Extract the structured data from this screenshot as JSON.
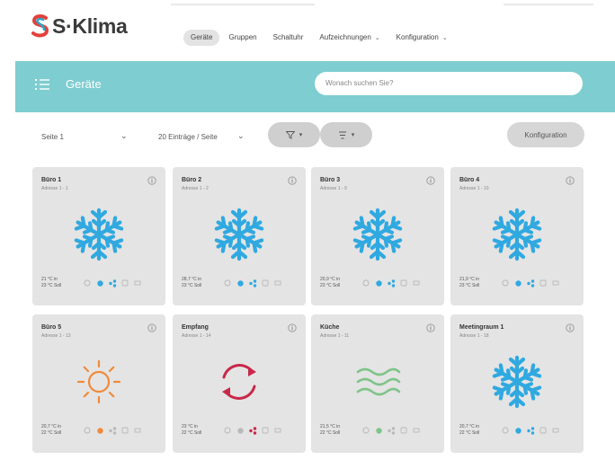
{
  "brand": {
    "name": "S·Klima"
  },
  "nav": {
    "items": [
      {
        "label": "Geräte",
        "active": true
      },
      {
        "label": "Gruppen",
        "active": false
      },
      {
        "label": "Schaltuhr",
        "active": false
      },
      {
        "label": "Aufzeichnungen",
        "active": false,
        "dropdown": true
      },
      {
        "label": "Konfiguration",
        "active": false,
        "dropdown": true
      }
    ]
  },
  "header": {
    "title": "Geräte",
    "search_placeholder": "Wonach suchen Sie?"
  },
  "toolbar": {
    "page_select": "Seite 1",
    "per_page_select": "20 Einträge / Seite",
    "konfiguration_label": "Konfiguration"
  },
  "colors": {
    "accent_teal": "#7ecdd0",
    "snow_blue": "#30a9e0",
    "sun_orange": "#f08a3a",
    "cycle_red": "#c8284a",
    "wave_green": "#7fc48a"
  },
  "devices": [
    {
      "name": "Büro 1",
      "address": "Adresse 1 - 1",
      "temp_line1": "21 °C in",
      "temp_line2": "23 °C Soll",
      "mode_icon": "snowflake-icon"
    },
    {
      "name": "Büro 2",
      "address": "Adresse 1 - 2",
      "temp_line1": "28,7 °C in",
      "temp_line2": "23 °C Soll",
      "mode_icon": "snowflake-icon"
    },
    {
      "name": "Büro 3",
      "address": "Adresse 1 - 9",
      "temp_line1": "20,9 °C in",
      "temp_line2": "23 °C Soll",
      "mode_icon": "snowflake-icon"
    },
    {
      "name": "Büro 4",
      "address": "Adresse 1 - 10",
      "temp_line1": "21,9 °C in",
      "temp_line2": "23 °C Soll",
      "mode_icon": "snowflake-icon"
    },
    {
      "name": "Büro 5",
      "address": "Adresse 1 - 13",
      "temp_line1": "20,7 °C in",
      "temp_line2": "22 °C Soll",
      "mode_icon": "sun-icon"
    },
    {
      "name": "Empfang",
      "address": "Adresse 1 - 14",
      "temp_line1": "23 °C in",
      "temp_line2": "22 °C Soll",
      "mode_icon": "auto-cycle-icon"
    },
    {
      "name": "Küche",
      "address": "Adresse 1 - 11",
      "temp_line1": "21,5 °C in",
      "temp_line2": "22 °C Soll",
      "mode_icon": "fan-waves-icon"
    },
    {
      "name": "Meetingraum 1",
      "address": "Adresse 1 - 18",
      "temp_line1": "20,7 °C in",
      "temp_line2": "22 °C Soll",
      "mode_icon": "snowflake-icon"
    }
  ]
}
